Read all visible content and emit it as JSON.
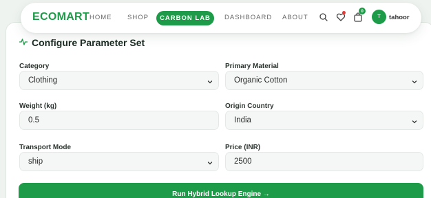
{
  "nav": {
    "logo": "ECOMART",
    "items": [
      "HOME",
      "SHOP",
      "CARBON LAB",
      "DASHBOARD",
      "ABOUT"
    ],
    "active": "CARBON LAB",
    "cart_count": "0",
    "avatar_initial": "T",
    "username": "tahoor"
  },
  "form": {
    "title": "Configure Parameter Set",
    "category_label": "Category",
    "category_value": "Clothing",
    "material_label": "Primary Material",
    "material_value": "Organic Cotton",
    "weight_label": "Weight (kg)",
    "weight_value": "0.5",
    "origin_label": "Origin Country",
    "origin_value": "India",
    "transport_label": "Transport Mode",
    "transport_value": "ship",
    "price_label": "Price (INR)",
    "price_value": "2500",
    "submit_label": "Run Hybrid Lookup Engine →"
  },
  "colors": {
    "accent": "#1e9b48",
    "background": "#eef3ef",
    "field_bg": "#f4f7f5"
  }
}
